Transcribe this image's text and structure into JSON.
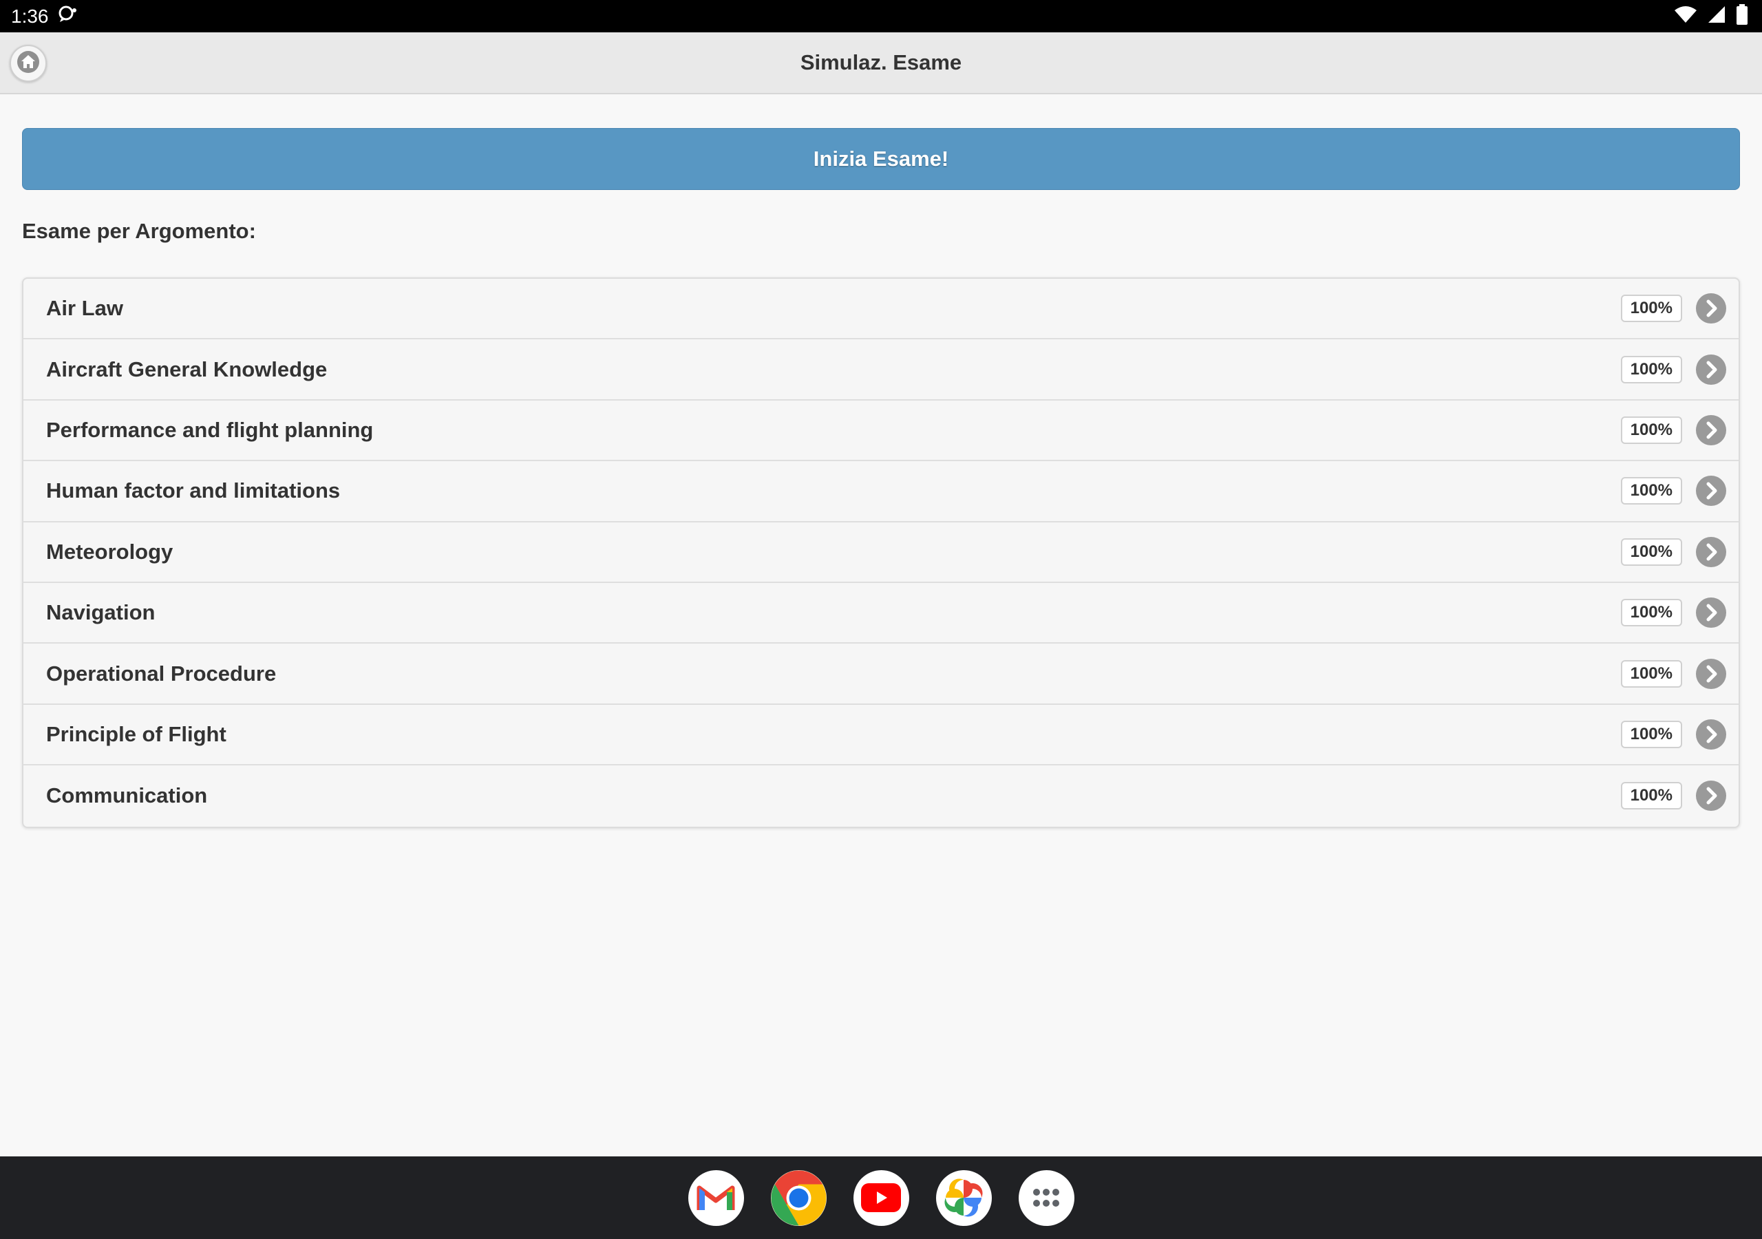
{
  "status_bar": {
    "time": "1:36"
  },
  "header": {
    "title": "Simulaz. Esame"
  },
  "start_button_label": "Inizia Esame!",
  "section_heading": "Esame per Argomento:",
  "topics": [
    {
      "label": "Air Law",
      "count": "100%"
    },
    {
      "label": "Aircraft General Knowledge",
      "count": "100%"
    },
    {
      "label": "Performance and flight planning",
      "count": "100%"
    },
    {
      "label": "Human factor and limitations",
      "count": "100%"
    },
    {
      "label": "Meteorology",
      "count": "100%"
    },
    {
      "label": "Navigation",
      "count": "100%"
    },
    {
      "label": "Operational Procedure",
      "count": "100%"
    },
    {
      "label": "Principle of Flight",
      "count": "100%"
    },
    {
      "label": "Communication",
      "count": "100%"
    }
  ],
  "dock": [
    "gmail-icon",
    "chrome-icon",
    "youtube-icon",
    "photos-icon",
    "app-drawer-icon"
  ],
  "colors": {
    "accent": "#5897c3",
    "status_bar": "#000000",
    "nav_bar": "#202124"
  }
}
